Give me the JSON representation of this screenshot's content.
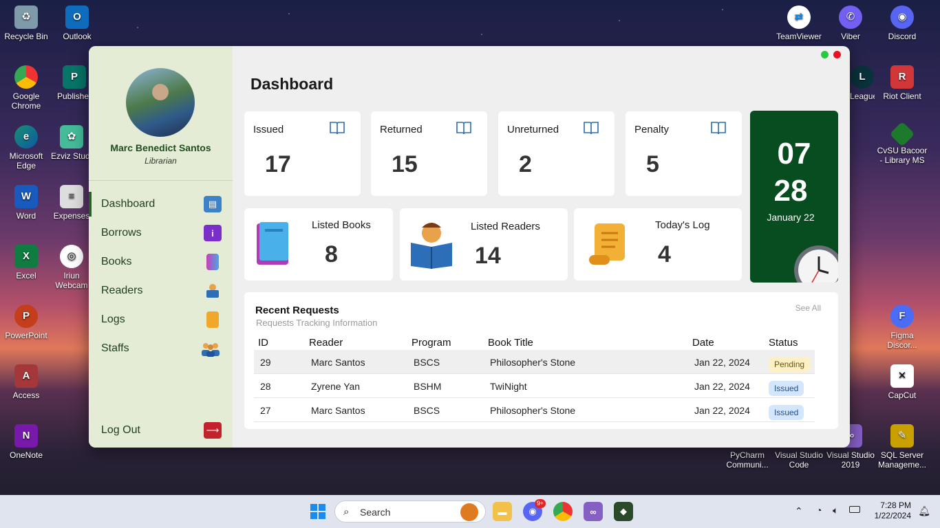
{
  "desktop": {
    "left_icons": [
      {
        "label": "Recycle Bin",
        "icon": "recycle-bin-icon",
        "color": "#8aa"
      },
      {
        "label": "Outlook",
        "icon": "outlook-icon",
        "color": "#0f6cbd"
      },
      {
        "label": "Google Chrome",
        "icon": "chrome-icon",
        "color": "#e33"
      },
      {
        "label": "Publisher",
        "icon": "publisher-icon",
        "color": "#077568"
      },
      {
        "label": "Microsoft Edge",
        "icon": "edge-icon",
        "color": "#1a8f6f"
      },
      {
        "label": "Ezviz Studio",
        "icon": "ezviz-icon",
        "color": "#4b9"
      },
      {
        "label": "Word",
        "icon": "word-icon",
        "color": "#185abd"
      },
      {
        "label": "Expenses",
        "icon": "file-icon",
        "color": "#ccc"
      },
      {
        "label": "Excel",
        "icon": "excel-icon",
        "color": "#107c41"
      },
      {
        "label": "Iriun Webcam",
        "icon": "iriun-icon",
        "color": "#222"
      },
      {
        "label": "PowerPoint",
        "icon": "powerpoint-icon",
        "color": "#c43e1c"
      },
      {
        "label": "Access",
        "icon": "access-icon",
        "color": "#a4373a"
      },
      {
        "label": "OneNote",
        "icon": "onenote-icon",
        "color": "#7719aa"
      }
    ],
    "right_icons": [
      {
        "label": "TeamViewer",
        "icon": "teamviewer-icon",
        "color": "#0e8ee9"
      },
      {
        "label": "Viber",
        "icon": "viber-icon",
        "color": "#7360f2"
      },
      {
        "label": "Discord",
        "icon": "discord-icon",
        "color": "#5865f2"
      },
      {
        "label": "Riot Client",
        "icon": "riot-icon",
        "color": "#d13639"
      },
      {
        "label": "League of Legends",
        "icon": "league-icon",
        "color": "#0a323c"
      },
      {
        "label": "CvSU Bacoor - Library MS",
        "icon": "library-ms-icon",
        "color": "#1d7a2d"
      },
      {
        "label": "Figma Discor...",
        "icon": "figma-icon",
        "color": "#4a6cf7"
      },
      {
        "label": "CapCut",
        "icon": "capcut-icon",
        "color": "#111"
      },
      {
        "label": "PyCharm Communi...",
        "icon": "pycharm-icon",
        "color": "#21d789"
      },
      {
        "label": "Visual Studio Code",
        "icon": "vscode-icon",
        "color": "#007acc"
      },
      {
        "label": "Visual Studio 2019",
        "icon": "visual-studio-icon",
        "color": "#865fc5"
      },
      {
        "label": "SQL Server Manageme...",
        "icon": "sql-server-icon",
        "color": "#c8a000"
      }
    ]
  },
  "sidebar": {
    "user_name": "Marc Benedict Santos",
    "user_role": "Librarian",
    "items": [
      {
        "label": "Dashboard",
        "icon": "dashboard-icon"
      },
      {
        "label": "Borrows",
        "icon": "info-icon"
      },
      {
        "label": "Books",
        "icon": "book-icon"
      },
      {
        "label": "Readers",
        "icon": "reader-icon"
      },
      {
        "label": "Logs",
        "icon": "scroll-icon"
      },
      {
        "label": "Staffs",
        "icon": "staff-icon"
      }
    ],
    "logout_label": "Log Out"
  },
  "main": {
    "title": "Dashboard",
    "stats": [
      {
        "label": "Issued",
        "value": "17"
      },
      {
        "label": "Returned",
        "value": "15"
      },
      {
        "label": "Unreturned",
        "value": "2"
      },
      {
        "label": "Penalty",
        "value": "5"
      }
    ],
    "clock": {
      "hour": "07",
      "minute": "28",
      "date": "January 22"
    },
    "summary": [
      {
        "label": "Listed Books",
        "value": "8"
      },
      {
        "label": "Listed Readers",
        "value": "14"
      },
      {
        "label": "Today's Log",
        "value": "4"
      }
    ],
    "requests": {
      "title": "Recent Requests",
      "subtitle": "Requests Tracking Information",
      "see_all": "See All",
      "columns": [
        "ID",
        "Reader",
        "Program",
        "Book Title",
        "Date",
        "Status"
      ],
      "rows": [
        {
          "id": "29",
          "reader": "Marc Santos",
          "program": "BSCS",
          "book": "Philosopher's Stone",
          "date": "Jan 22, 2024",
          "status": "Pending"
        },
        {
          "id": "28",
          "reader": "Zyrene Yan",
          "program": "BSHM",
          "book": "TwiNight",
          "date": "Jan 22, 2024",
          "status": "Issued"
        },
        {
          "id": "27",
          "reader": "Marc Santos",
          "program": "BSCS",
          "book": "Philosopher's Stone",
          "date": "Jan 22, 2024",
          "status": "Issued"
        }
      ]
    }
  },
  "taskbar": {
    "search_placeholder": "Search",
    "time": "7:28 PM",
    "date": "1/22/2024",
    "discord_badge": "9+"
  },
  "colors": {
    "sidebar_bg": "#e4ecd6",
    "accent_green": "#074d1f",
    "pending_bg": "#fdf0c4",
    "issued_bg": "#d4e6fb"
  }
}
